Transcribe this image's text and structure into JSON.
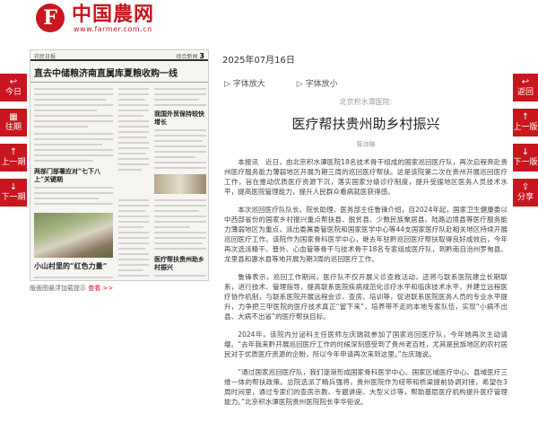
{
  "header": {
    "logo_glyph": "F",
    "logo_text": "中国農网",
    "logo_url": "www.farmer.com.cn"
  },
  "left_nav": [
    {
      "icon": "↩",
      "icon_name": "back-icon",
      "label": "今日"
    },
    {
      "icon": "▦",
      "icon_name": "calendar-icon",
      "label": "往期"
    },
    {
      "icon": "↑",
      "icon_name": "up-arrow-icon",
      "label": "上一期"
    },
    {
      "icon": "↓",
      "icon_name": "down-arrow-icon",
      "label": "下一期"
    }
  ],
  "right_nav": [
    {
      "icon": "↩",
      "icon_name": "return-icon",
      "label": "返回"
    },
    {
      "icon": "↑",
      "icon_name": "up-arrow-icon",
      "label": "上一版"
    },
    {
      "icon": "↓",
      "icon_name": "down-arrow-icon",
      "label": "下一版"
    },
    {
      "icon": "⇪",
      "icon_name": "share-icon",
      "label": "分享"
    }
  ],
  "paper": {
    "masthead": "农民日报",
    "section": "综合新闻",
    "page_no": "3",
    "headline": "直去中储粮济南直属库夏粮收购一线",
    "blocks": [
      "两部门部署应对“七下八上”关键期",
      "我国外贸保持较快增长",
      "小山村里的“红色力量”",
      "医疗帮扶贵州助乡村振兴"
    ]
  },
  "paper_caption": {
    "text": "版面图悬浮加载提示",
    "link": "查看 >>"
  },
  "date": "2025年07月16日",
  "font_controls": {
    "bigger": "字体放大",
    "smaller": "字体放小"
  },
  "article": {
    "kicker": "北京积水潭医院:",
    "title": "医疗帮扶贵州助乡村振兴",
    "byline": "蒋诗琳",
    "paragraphs": [
      "本报讯　近日，由北京积水潭医院18名技术骨干组成的国家巡回医疗队，再次启程奔赴贵州医疗服务能力薄弱地区开展为期三周的巡回医疗帮扶。这是该院第二次在贵州开展巡回医疗工作，旨在推动优质医疗资源下沉，落实国家分级诊疗制度，提升受援地区医务人员技术水平，提高医院管理能力，提升人民群众看病就医获得感。",
      "本次巡回医疗队队长、院长助理、医务部主任鲁锋介绍，自2024年起，国家卫生健康委以中西部省份的国家乡村振兴重点帮扶县、脱贫县、少数民族聚居县、陆路边境县等医疗服务能力薄弱地区为重点，派出委属委管医院和国家医学中心等44支国家医疗队赴相关地区持续开展巡回医疗工作。该院作为国家骨科医学中心，继去年驻黔巡回医疗帮扶取得良好成效后，今年再次选派精干、普外、心血管等骨干与技术骨干18名专家组成医疗队，到黔南自治州罗甸县、龙里县和惠水县等地开展为期3周的巡回医疗工作。",
      "鲁锋表示，巡回工作期间，医疗队不仅开展义诊查救活动，还将与联系医院建立长期联系，进行技术、管理指导，提高联系医院疾病规范化诊疗水平和临床技术水平，并建立远程医疗协作机制，与联系医院开展远程会诊、查房、培训等，促进联系医院医务人员的专业水平提升，力争把三甲医院的医疗技术真正“留下来”，培养带不走的本地专家队伍，实现“小病不出县、大病不出省”的医疗帮扶目标。",
      "2024年，该院内分泌科主任医师左庆瑞就参加了国家巡回医疗队，今年她再次主动请缨。“去年我来黔开展巡回医疗工作的时候深刻感受到了贵州老百姓，尤其是民族地区的农村居民对于优质医疗资源的企盼，所以今年申请再次来到这里。”左庆瑞说。",
      "“通过国家巡回医疗队，我们逐渐形成国家骨科医学中心、国家区域医疗中心、县域医疗三维一体的帮扶政策。总院选派了精兵强将，贵州医院作为纽带和桥梁提前协调对接，希望在3周时间里，通过专家们的查房示教、专题讲座、大型义诊等，帮助基层医疗机构提升医疗管理能力。”北京积水潭医院贵州医院院长李华钜说。"
    ]
  }
}
